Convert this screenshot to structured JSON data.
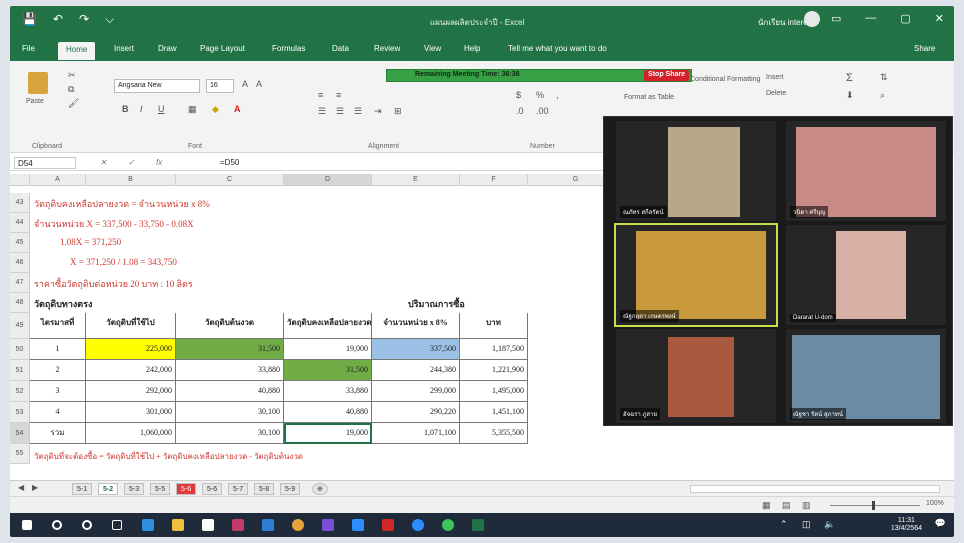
{
  "titlebar": {
    "quick_access": [
      "💾",
      "↶",
      "↷",
      "⌵"
    ],
    "document_title": "แผนผลผลิตประจำปี - Excel",
    "user_name": "นักเรียน interes",
    "window_buttons": [
      "▭",
      "—",
      "▢",
      "✕"
    ]
  },
  "ribbon_tabs": [
    "File",
    "Home",
    "Insert",
    "Draw",
    "Page Layout",
    "Formulas",
    "Data",
    "Review",
    "View",
    "Help",
    "Tell me what you want to do",
    "Share"
  ],
  "ribbon": {
    "groups": [
      "Clipboard",
      "Font",
      "Alignment",
      "Number"
    ],
    "paste_label": "Paste",
    "font_name": "Angsana New",
    "font_size": "16",
    "right_items": [
      "Insert",
      "Delete",
      "Format as Table",
      "Conditional Formatting"
    ]
  },
  "zoom_share": {
    "timer_text": "Remaining Meeting Time: 36:38",
    "stop_share_label": "Stop Share"
  },
  "formula_bar": {
    "name_box": "D54",
    "fx": "fx",
    "formula": "=D50"
  },
  "columns": [
    "A",
    "B",
    "C",
    "D",
    "E",
    "F",
    "G"
  ],
  "row_numbers": [
    "43",
    "44",
    "45",
    "46",
    "47",
    "48",
    "49",
    "50",
    "51",
    "52",
    "53",
    "54",
    "55"
  ],
  "notes": {
    "r43": "วัตถุดิบคงเหลือปลายงวด = จำนวนหน่วย x 8%",
    "r44": "จำนวนหน่วย X = 337,500 - 33,750 - 0.08X",
    "r45": "1.08X = 371,250",
    "r46": "X = 371,250 / 1.08 = 343,750",
    "r47": "ราคาซื้อวัตถุดิบต่อหน่วย 20 บาท : 10 ลิตร"
  },
  "table": {
    "section_title": "วัตถุดิบทางตรง",
    "purchase_title": "ปริมาณการซื้อ",
    "headers": [
      "ไตรมาสที่",
      "วัตถุดิบที่ใช้ไป",
      "วัตถุดิบต้นงวด",
      "วัตถุดิบคงเหลือปลายงวด",
      "จำนวนหน่วย x 8%",
      "บาท"
    ],
    "rows": [
      [
        "1",
        "225,000",
        "31,500",
        "19,000",
        "337,500",
        "1,187,500"
      ],
      [
        "2",
        "242,000",
        "33,880",
        "31,500",
        "244,380",
        "1,221,900"
      ],
      [
        "3",
        "292,000",
        "40,880",
        "33,880",
        "299,000",
        "1,495,000"
      ],
      [
        "4",
        "301,000",
        "30,100",
        "40,880",
        "290,220",
        "1,451,100"
      ],
      [
        "รวม",
        "1,060,000",
        "30,100",
        "19,000",
        "1,071,100",
        "5,355,500"
      ]
    ],
    "footnote": "วัตถุดิบที่จะต้องซื้อ = วัตถุดิบที่ใช้ไป + วัตถุดิบคงเหลือปลายงวด - วัตถุดิบต้นงวด"
  },
  "sheet_tabs": [
    "5-1",
    "5-2",
    "5-3",
    "5-5",
    "5-6",
    "5-6",
    "5-7",
    "5-8",
    "5-9",
    "⊕"
  ],
  "statusbar": {
    "zoom": "100%"
  },
  "zoom_participants": [
    {
      "name": "ณภัทร สกีลรัตน์",
      "speaking": false
    },
    {
      "name": "วนิดา ศรีบุญ",
      "speaking": false
    },
    {
      "name": "ณัฐกฤตา เกษตรพงษ์",
      "speaking": true
    },
    {
      "name": "Dararat U-dom",
      "speaking": false
    },
    {
      "name": "อัจฉรา ภูสาย",
      "speaking": false
    },
    {
      "name": "ณัฐชา รัตน์ สุภาทน์",
      "speaking": false
    }
  ],
  "taskbar": {
    "time": "11:31",
    "date": "13/4/2564"
  },
  "colors": {
    "excel_green": "#217346",
    "highlight_yellow": "#ffff00",
    "highlight_green": "#70ad47",
    "highlight_blue": "#9bc2e6",
    "note_red": "#d0372e"
  }
}
